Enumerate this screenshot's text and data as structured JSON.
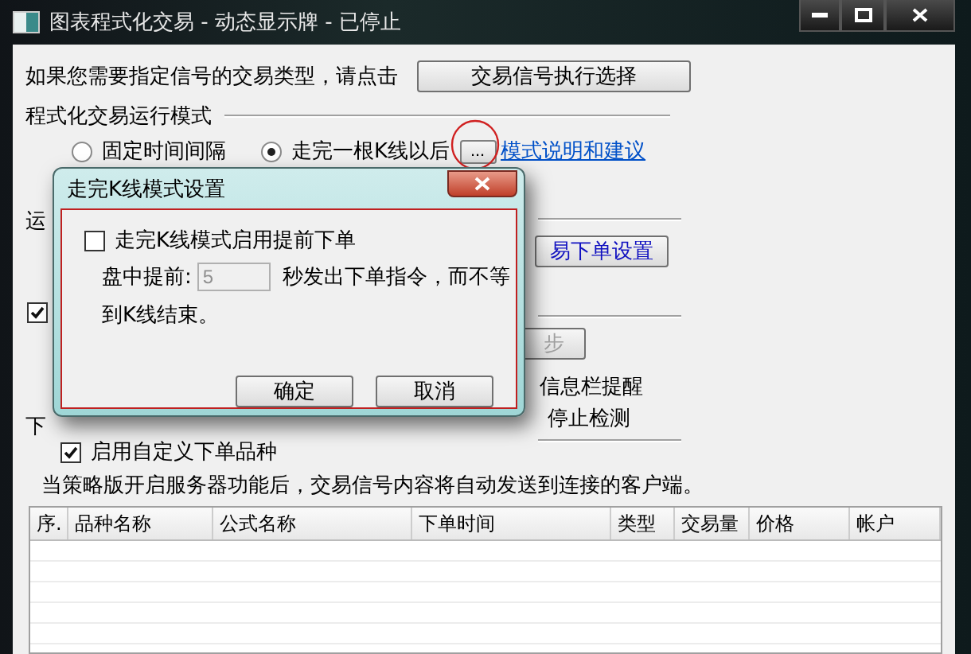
{
  "window": {
    "title": "图表程式化交易 - 动态显示牌 - 已停止"
  },
  "signal_type": {
    "prompt": "如果您需要指定信号的交易类型，请点击",
    "button": "交易信号执行选择"
  },
  "run_mode": {
    "heading": "程式化交易运行模式",
    "options": [
      {
        "label": "固定时间间隔",
        "selected": false
      },
      {
        "label": "走完一根K线以后",
        "selected": true
      }
    ],
    "more_button": "...",
    "help_link": "模式说明和建议"
  },
  "covered_section": {
    "label_fragment": "运",
    "order_settings_button": "易下单设置",
    "checked": true,
    "sync_button": "步",
    "sync_disabled": true,
    "notify_text": "信息栏提醒",
    "stop_text": "停止检测",
    "order_label_fragment": "下"
  },
  "custom_symbols": {
    "label": "启用自定义下单品种",
    "checked": true
  },
  "server_note": "当策略版开启服务器功能后，交易信号内容将自动发送到连接的客户端。",
  "table": {
    "columns": [
      "序.",
      "品种名称",
      "公式名称",
      "下单时间",
      "类型",
      "交易量",
      "价格",
      "帐户"
    ]
  },
  "dialog": {
    "title": "走完K线模式设置",
    "early_order": {
      "label": "走完K线模式启用提前下单",
      "checked": false
    },
    "lead_label": "盘中提前:",
    "lead_value": "5",
    "lead_disabled": true,
    "lead_suffix": "秒发出下单指令，而不等",
    "lead_suffix_2": "到K线结束。",
    "buttons": [
      "确定",
      "取消"
    ]
  }
}
